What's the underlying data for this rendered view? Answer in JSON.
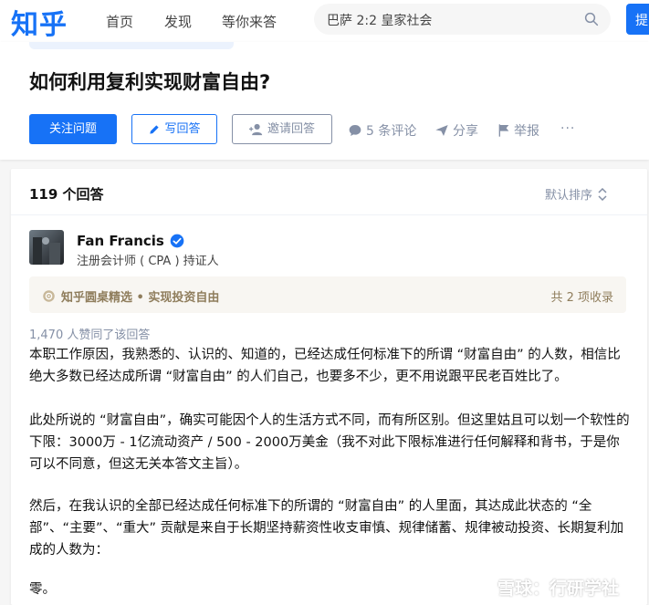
{
  "topbar": {
    "logo": "知乎",
    "nav": [
      "首页",
      "发现",
      "等你来答"
    ],
    "search_value": "巴萨 2:2 皇家社会",
    "ask_label": "提"
  },
  "question": {
    "title": "如何利用复利实现财富自由?",
    "follow_label": "关注问题",
    "write_label": "写回答",
    "invite_label": "邀请回答",
    "comments_label": "5 条评论",
    "share_label": "分享",
    "report_label": "举报",
    "more_label": "···"
  },
  "answers": {
    "count_label": "119 个回答",
    "sort_label": "默认排序"
  },
  "answer": {
    "author_name": "Fan Francis",
    "author_headline": "注册会计师 ( CPA ) 持证人",
    "collection_label": "知乎圆桌精选 • 实现投资自由",
    "collection_count": "共 2 项收录",
    "likes_label": "1,470 人赞同了该回答",
    "paragraphs": [
      "本职工作原因，我熟悉的、认识的、知道的，已经达成任何标准下的所谓 “财富自由” 的人数，相信比绝大多数已经达成所谓 “财富自由” 的人们自己，也要多不少，更不用说跟平民老百姓比了。",
      "此处所说的 “财富自由”，确实可能因个人的生活方式不同，而有所区别。但这里姑且可以划一个软性的下限：3000万 - 1亿流动资产 / 500 - 2000万美金（我不对此下限标准进行任何解释和背书，于是你可以不同意，但这无关本答文主旨）。",
      "然后，在我认识的全部已经达成任何标准下的所谓的 “财富自由” 的人里面，其达成此状态的 “全部”、“主要”、“重大” 贡献是来自于长期坚持薪资性收支审慎、规律储蓄、规律被动投资、长期复利加成的人数为：",
      "零。"
    ]
  },
  "watermark": "雪球：行研学社",
  "colors": {
    "brand": "#1772f6",
    "gold": "#8f7d5c",
    "muted": "#8590a6"
  }
}
